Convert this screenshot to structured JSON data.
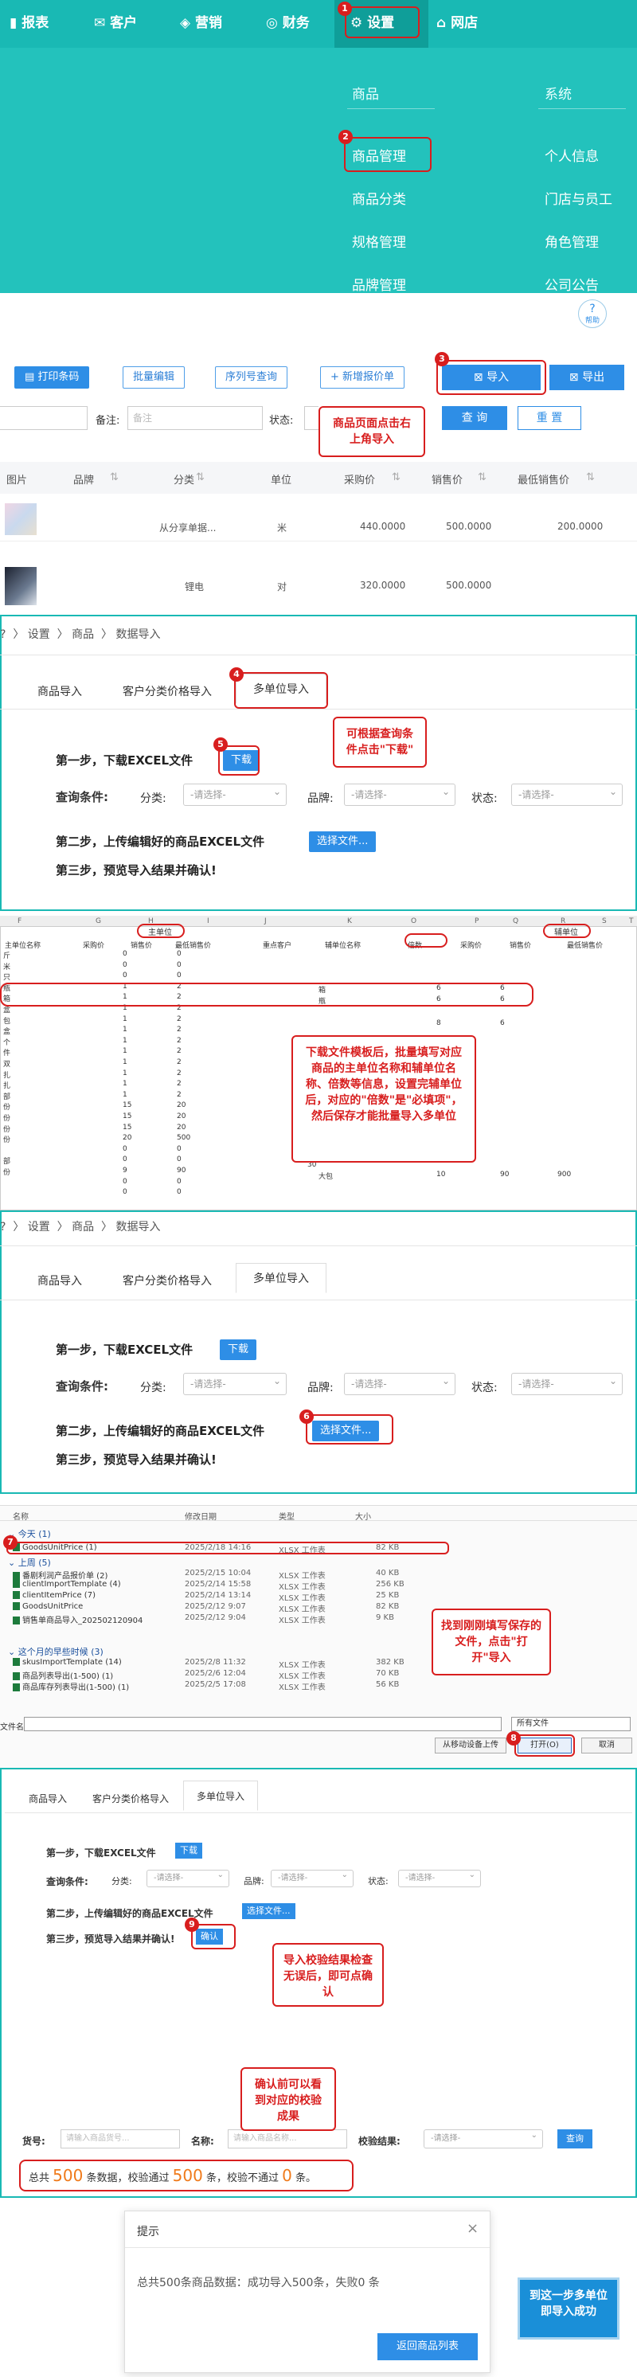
{
  "nav": {
    "items": [
      "报表",
      "客户",
      "营销",
      "财务",
      "设置",
      "网店"
    ],
    "menu": {
      "col1_title": "商品",
      "col2_title": "系统",
      "col1": [
        "商品管理",
        "商品分类",
        "规格管理",
        "品牌管理"
      ],
      "col2": [
        "个人信息",
        "门店与员工",
        "角色管理",
        "公司公告"
      ]
    }
  },
  "help": "帮助",
  "list": {
    "toolbar": [
      "打印条码",
      "批量编辑",
      "序列号查询",
      "+ 新增报价单"
    ],
    "import": "导入",
    "export": "导出",
    "remark_label": "备注:",
    "remark_placeholder": "备注",
    "status_label": "状态:",
    "query": "查 询",
    "reset": "重 置",
    "headers": [
      "图片",
      "品牌",
      "分类",
      "单位",
      "采购价",
      "销售价",
      "最低销售价"
    ],
    "rows": [
      {
        "category": "从分享单据...",
        "unit": "米",
        "purchase": "440.0000",
        "sale": "500.0000",
        "min": "200.0000"
      },
      {
        "category": "锂电",
        "unit": "对",
        "purchase": "320.0000",
        "sale": "500.0000",
        "min": ""
      }
    ]
  },
  "callouts": {
    "c3": "商品页面点击右上角导入",
    "c5": "可根据查询条件点击\"下载\"",
    "c_excel": "下载文件模板后，批量填写对应商品的主单位名称和辅单位名称、倍数等信息，设置完辅单位后，对应的\"倍数\"是\"必填项\"，然后保存才能批量导入多单位",
    "c7": "找到刚刚填写保存的文件，点击\"打开\"导入",
    "c9": "导入校验结果检查无误后，即可点确认",
    "c_check": "确认前可以看到对应的校验成果",
    "c_done": "到这一步多单位即导入成功"
  },
  "import": {
    "breadcrumb": [
      "设置",
      "商品",
      "数据导入"
    ],
    "tabs": [
      "商品导入",
      "客户分类价格导入",
      "多单位导入"
    ],
    "step1": "第一步，下载EXCEL文件",
    "download": "下载",
    "query_label": "查询条件:",
    "category_label": "分类:",
    "brand_label": "品牌:",
    "status_label": "状态:",
    "select_placeholder": "-请选择-",
    "step2": "第二步，上传编辑好的商品EXCEL文件",
    "choose_file": "选择文件...",
    "step3": "第三步，预览导入结果并确认!",
    "confirm": "确认"
  },
  "excel": {
    "cols": [
      "F",
      "G",
      "H",
      "I",
      "J",
      "K",
      "O",
      "P",
      "Q",
      "R",
      "S",
      "T"
    ],
    "main_unit": "主单位",
    "sub_unit": "辅单位",
    "headers": [
      "主单位名称",
      "采购价",
      "销售价",
      "最低销售价",
      "重点客户",
      "辅单位名称",
      "倍数",
      "采购价",
      "销售价",
      "最低销售价"
    ],
    "rows": [
      [
        "斤",
        "0",
        "0"
      ],
      [
        "米",
        "0",
        "0"
      ],
      [
        "只",
        "0",
        "0"
      ],
      [
        "瓶",
        "1",
        "2",
        "",
        "",
        "",
        "",
        "",
        "",
        ""
      ],
      [
        "箱",
        "1",
        "2",
        "",
        "",
        "",
        "",
        "",
        "",
        ""
      ],
      [
        "盒",
        "1",
        "2"
      ],
      [
        "包",
        "1",
        "2"
      ],
      [
        "盒",
        "1",
        "2"
      ],
      [
        "个",
        "1",
        "2"
      ],
      [
        "件",
        "1",
        "2"
      ],
      [
        "双",
        "1",
        "2"
      ],
      [
        "扎",
        "1",
        "2"
      ],
      [
        "扎",
        "1",
        "2"
      ],
      [
        "部",
        "1",
        "2"
      ],
      [
        "份",
        "15",
        "20"
      ],
      [
        "份",
        "15",
        "20"
      ],
      [
        "份",
        "15",
        "20"
      ],
      [
        "份",
        "20",
        "500"
      ],
      [
        "",
        "0",
        "0"
      ],
      [
        "部",
        "0",
        "0"
      ],
      [
        "份",
        "9",
        "90"
      ],
      [
        "",
        "0",
        "0"
      ],
      [
        "",
        "0",
        "0"
      ]
    ],
    "sub_rows": [
      {
        "name": "箱",
        "mult": "6",
        "pur": "6"
      },
      {
        "name": "瓶",
        "mult": "6",
        "pur": "6"
      },
      {
        "name": "",
        "mult": "8",
        "pur": "6"
      },
      {
        "name": "大包",
        "mult": "10",
        "pur": "90",
        "sale": "900"
      }
    ],
    "thirty": "30"
  },
  "dialog": {
    "headers": [
      "名称",
      "修改日期",
      "类型",
      "大小"
    ],
    "today": "今天 (1)",
    "lastweek": "上周 (5)",
    "earlier": "这个月的早些时候 (3)",
    "files": [
      {
        "name": "GoodsUnitPrice (1)",
        "date": "2025/2/18 14:16",
        "type": "XLSX 工作表",
        "size": "82 KB"
      },
      {
        "name": "番剧利润产品报价单 (2)",
        "date": "2025/2/15 10:04",
        "type": "XLSX 工作表",
        "size": "40 KB"
      },
      {
        "name": "clientImportTemplate (4)",
        "date": "2025/2/14 15:58",
        "type": "XLSX 工作表",
        "size": "256 KB"
      },
      {
        "name": "clientItemPrice (7)",
        "date": "2025/2/14 13:14",
        "type": "XLSX 工作表",
        "size": "25 KB"
      },
      {
        "name": "GoodsUnitPrice",
        "date": "2025/2/12 9:07",
        "type": "XLSX 工作表",
        "size": "82 KB"
      },
      {
        "name": "销售单商品导入_202502120904",
        "date": "2025/2/12 9:04",
        "type": "XLSX 工作表",
        "size": "9 KB"
      },
      {
        "name": "skusImportTemplate (14)",
        "date": "2025/2/8 11:32",
        "type": "XLSX 工作表",
        "size": "382 KB"
      },
      {
        "name": "商品列表导出(1-500) (1)",
        "date": "2025/2/6 12:04",
        "type": "XLSX 工作表",
        "size": "70 KB"
      },
      {
        "name": "商品库存列表导出(1-500) (1)",
        "date": "2025/2/5 17:08",
        "type": "XLSX 工作表",
        "size": "56 KB"
      }
    ],
    "filename_label": "文件名(N):",
    "filetype": "所有文件",
    "upload_mobile": "从移动设备上传",
    "open": "打开(O)",
    "cancel": "取消"
  },
  "preview": {
    "goods_no": "货号:",
    "goods_no_ph": "请输入商品货号...",
    "name": "名称:",
    "name_ph": "请输入商品名称...",
    "check_result": "校验结果:",
    "query": "查询",
    "sum_pre": "总共",
    "total": "500",
    "sum_mid1": "条数据，校验通过",
    "pass": "500",
    "sum_mid2": "条，校验不通过",
    "fail": "0",
    "sum_end": "条。"
  },
  "toast": {
    "title": "提示",
    "close": "×",
    "msg": "总共500条商品数据：成功导入500条，失败0 条",
    "btn": "返回商品列表"
  },
  "colors": {
    "teal": "#1fbfb8",
    "red": "#d81e1e",
    "blue": "#2e8ee6"
  }
}
